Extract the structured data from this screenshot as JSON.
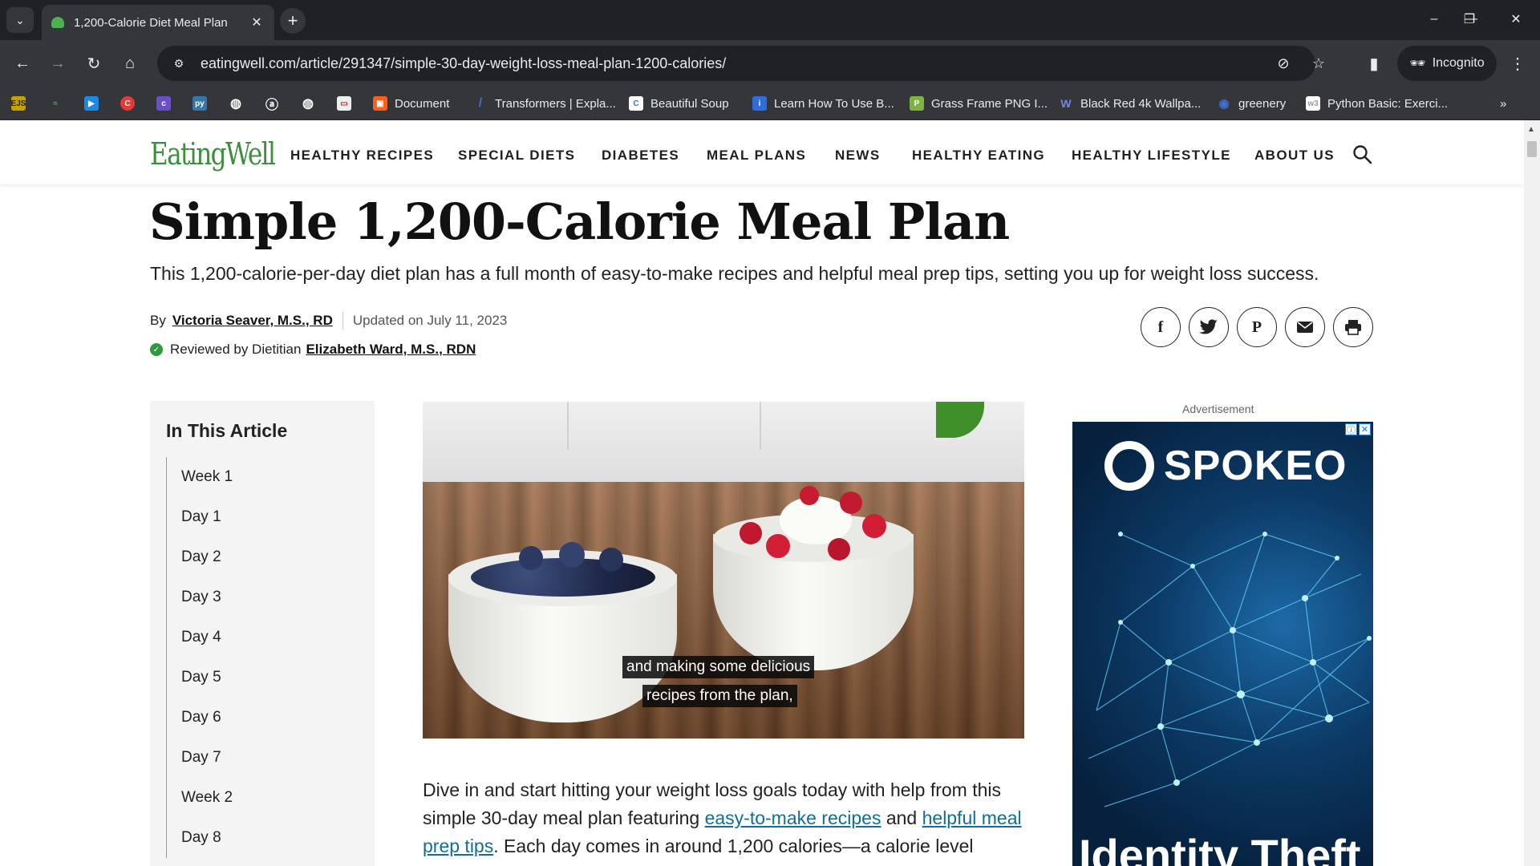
{
  "browser": {
    "tab_title": "1,200-Calorie Diet Meal Plan",
    "url": "eatingwell.com/article/291347/simple-30-day-weight-loss-meal-plan-1200-calories/",
    "incognito_label": "Incognito",
    "bookmarks": [
      {
        "label": "Document",
        "color": "#f4611f"
      },
      {
        "label": "Transformers | Expla...",
        "color": "#3b6fd1"
      },
      {
        "label": "Beautiful Soup",
        "color": "#ffffff"
      },
      {
        "label": "Learn How To Use B...",
        "color": "#2e6ed8"
      },
      {
        "label": "Grass Frame PNG I...",
        "color": "#7cb342"
      },
      {
        "label": "Black Red 4k Wallpa...",
        "color": "#5b6fd6"
      },
      {
        "label": "greenery",
        "color": "#3f6fd8"
      },
      {
        "label": "Python Basic: Exerci...",
        "color": "#ffffff"
      }
    ]
  },
  "site": {
    "logo": "EatingWell",
    "nav": [
      "HEALTHY RECIPES",
      "SPECIAL DIETS",
      "DIABETES",
      "MEAL PLANS",
      "NEWS",
      "HEALTHY EATING",
      "HEALTHY LIFESTYLE",
      "ABOUT US"
    ]
  },
  "article": {
    "title": "Simple 1,200-Calorie Meal Plan",
    "subtitle": "This 1,200-calorie-per-day diet plan has a full month of easy-to-make recipes and helpful meal prep tips, setting you up for weight loss success.",
    "by_label": "By",
    "author": "Victoria Seaver, M.S., RD",
    "updated": "Updated on July 11, 2023",
    "reviewed_label": "Reviewed by Dietitian",
    "reviewer": "Elizabeth Ward, M.S., RDN",
    "toc_title": "In This Article",
    "toc_items": [
      "Week 1",
      "Day 1",
      "Day 2",
      "Day 3",
      "Day 4",
      "Day 5",
      "Day 6",
      "Day 7",
      "Week 2",
      "Day 8"
    ],
    "video_caption_line1": "and making some delicious",
    "video_caption_line2": "recipes from the plan,",
    "body_part1": "Dive in and start hitting your weight loss goals today with help from this simple 30-day meal plan featuring ",
    "body_link1": "easy-to-make recipes",
    "body_part2": " and ",
    "body_link2": "helpful meal prep tips",
    "body_part3": ". Each day comes in around 1,200 calories—a calorie level"
  },
  "ad": {
    "label": "Advertisement",
    "brand": "SPOKEO",
    "headline": "Identity Theft"
  }
}
